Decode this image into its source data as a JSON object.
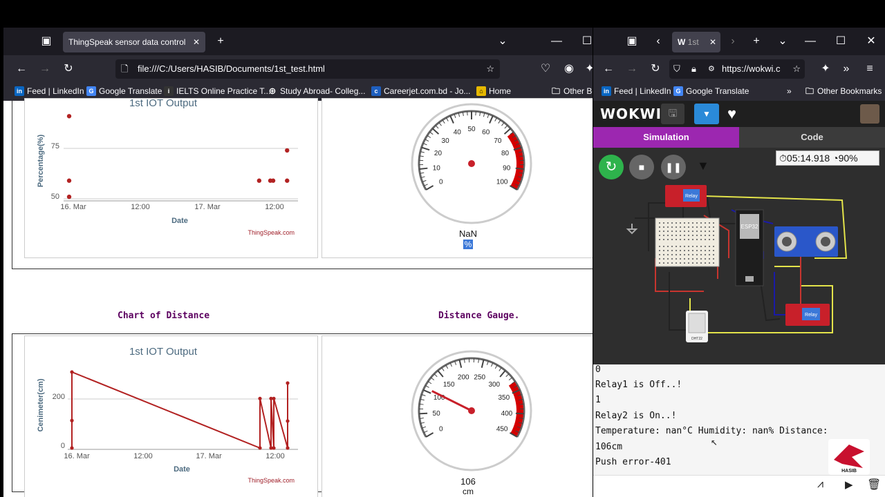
{
  "left_browser": {
    "tab_title": "ThingSpeak sensor data control",
    "url": "file:///C:/Users/HASIB/Documents/1st_test.html",
    "bookmarks": [
      "Feed | LinkedIn",
      "Google Translate",
      "IELTS Online Practice T...",
      "Study Abroad- Colleg...",
      "Careerjet.com.bd - Jo...",
      "Home",
      "Other Bo"
    ]
  },
  "page": {
    "heading_chart_distance": "Chart of Distance",
    "heading_gauge_distance": "Distance Gauge.",
    "top_chart": {
      "title": "1st IOT Output",
      "ylabel": "Percentage(%)",
      "xlabel": "Date",
      "yticks": [
        "75",
        "50"
      ],
      "xticks": [
        "16. Mar",
        "12:00",
        "17. Mar",
        "12:00"
      ],
      "credit": "ThingSpeak.com"
    },
    "top_gauge": {
      "ticks": [
        "0",
        "10",
        "20",
        "30",
        "40",
        "50",
        "60",
        "70",
        "80",
        "90",
        "100"
      ],
      "value_text": "NaN",
      "unit": "%"
    },
    "bottom_chart": {
      "title": "1st IOT Output",
      "ylabel": "Cenimeter(cm)",
      "xlabel": "Date",
      "yticks": [
        "200",
        "0"
      ],
      "xticks": [
        "16. Mar",
        "12:00",
        "17. Mar",
        "12:00"
      ],
      "credit": "ThingSpeak.com"
    },
    "bottom_gauge": {
      "ticks": [
        "0",
        "50",
        "100",
        "150",
        "200",
        "250",
        "300",
        "350",
        "400",
        "450"
      ],
      "value_text": "106",
      "unit": "cm",
      "value": 106
    }
  },
  "right_browser": {
    "tab_title": "1st",
    "url": "https://wokwi.c",
    "bookmarks": [
      "Feed | LinkedIn",
      "Google Translate",
      "Other Bookmarks"
    ],
    "brand": "WOKWI",
    "tab_simulation": "Simulation",
    "tab_code": "Code",
    "timer": "05:14.918",
    "speed": "90%",
    "chip_label": "ESP32",
    "relay_label": "Relay",
    "sensor_label": "DHT22",
    "serial_lines": [
      "0",
      "Relay1 is Off..!",
      "1",
      "Relay2 is On..!",
      "Temperature: nan°C  Humidity: nan%  Distance:",
      "106cm",
      "Push error-401"
    ],
    "watermark": "HASIB"
  },
  "colors": {
    "accent_purple": "#9c27b0",
    "data_red": "#b22222",
    "gauge_band_red": "#d40000",
    "heading_purple": "#5c0060"
  },
  "chart_data": [
    {
      "type": "scatter",
      "title": "1st IOT Output",
      "xlabel": "Date",
      "ylabel": "Percentage(%)",
      "x": [
        "16. Mar 00:00",
        "16. Mar 00:00",
        "16. Mar 00:00",
        "17. Mar 10:00",
        "17. Mar 12:00",
        "17. Mar 12:30",
        "17. Mar 15:00",
        "17. Mar 15:00"
      ],
      "y": [
        91,
        59,
        51,
        59,
        59,
        59,
        59,
        74
      ],
      "ylim": [
        50,
        100
      ]
    },
    {
      "type": "line",
      "title": "1st IOT Output",
      "xlabel": "Date",
      "ylabel": "Cenimeter(cm)",
      "x": [
        "16. Mar 00:00",
        "16. Mar 00:00",
        "16. Mar 00:00",
        "17. Mar 10:00",
        "17. Mar 10:00",
        "17. Mar 12:00",
        "17. Mar 12:00",
        "17. Mar 12:30",
        "17. Mar 12:30",
        "17. Mar 15:00",
        "17. Mar 15:00",
        "17. Mar 15:00"
      ],
      "y": [
        0,
        112,
        310,
        0,
        202,
        0,
        202,
        0,
        202,
        0,
        110,
        265
      ],
      "ylim": [
        0,
        300
      ]
    }
  ]
}
